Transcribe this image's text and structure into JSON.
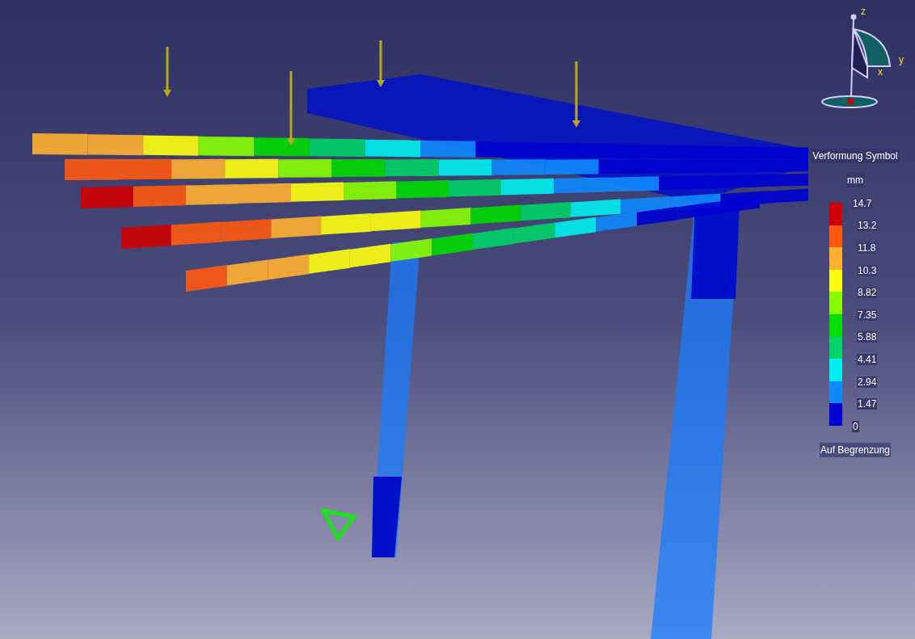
{
  "compass": {
    "axes": [
      "z",
      "y",
      "x"
    ]
  },
  "legend": {
    "title": "Verformung Symbol",
    "unit": "mm",
    "bands": [
      {
        "color": "#d00000"
      },
      {
        "color": "#ff5a10"
      },
      {
        "color": "#ffb030"
      },
      {
        "color": "#ffff10"
      },
      {
        "color": "#88ff00"
      },
      {
        "color": "#00dd00"
      },
      {
        "color": "#00d468"
      },
      {
        "color": "#00f0f0"
      },
      {
        "color": "#1088ff"
      },
      {
        "color": "#0000d0"
      }
    ],
    "labels": [
      "14.7",
      "13.2",
      "11.8",
      "10.3",
      "8.82",
      "7.35",
      "5.88",
      "4.41",
      "2.94",
      "1.47",
      "0"
    ],
    "footer": "Auf Begrenzung"
  }
}
